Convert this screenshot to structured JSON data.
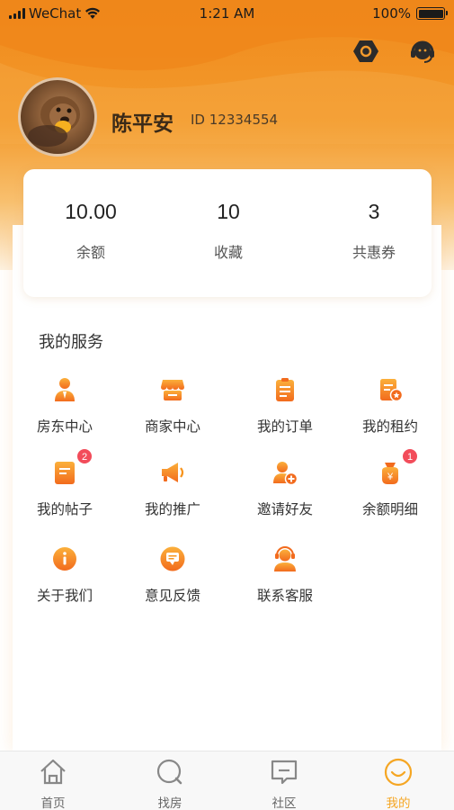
{
  "status_bar": {
    "carrier": "WeChat",
    "time": "1:21 AM",
    "battery": "100%"
  },
  "header": {
    "settings_icon": "hexagon-settings-icon",
    "support_icon": "headset-icon"
  },
  "profile": {
    "name": "陈平安",
    "id_text": "ID 12334554"
  },
  "stats": [
    {
      "value": "10.00",
      "label": "余额"
    },
    {
      "value": "10",
      "label": "收藏"
    },
    {
      "value": "3",
      "label": "共惠券"
    }
  ],
  "services": {
    "title": "我的服务",
    "items": [
      {
        "label": "房东中心",
        "icon": "landlord-icon"
      },
      {
        "label": "商家中心",
        "icon": "shop-icon"
      },
      {
        "label": "我的订单",
        "icon": "order-icon"
      },
      {
        "label": "我的租约",
        "icon": "lease-icon"
      },
      {
        "label": "我的帖子",
        "icon": "post-icon",
        "badge": "2"
      },
      {
        "label": "我的推广",
        "icon": "megaphone-icon"
      },
      {
        "label": "邀请好友",
        "icon": "invite-friend-icon"
      },
      {
        "label": "余额明细",
        "icon": "wallet-icon",
        "badge": "1"
      },
      {
        "label": "关于我们",
        "icon": "info-icon"
      },
      {
        "label": "意见反馈",
        "icon": "feedback-icon"
      },
      {
        "label": "联系客服",
        "icon": "customer-service-icon"
      }
    ]
  },
  "tab_bar": {
    "tabs": [
      {
        "label": "首页",
        "icon": "home-icon"
      },
      {
        "label": "找房",
        "icon": "search-icon"
      },
      {
        "label": "社区",
        "icon": "chat-icon"
      },
      {
        "label": "我的",
        "icon": "smile-icon",
        "active": true
      }
    ]
  },
  "colors": {
    "accent": "#f5a623",
    "header_top": "#f08a1c",
    "icon_orange": "#f7941d",
    "badge": "#f24c5a"
  }
}
